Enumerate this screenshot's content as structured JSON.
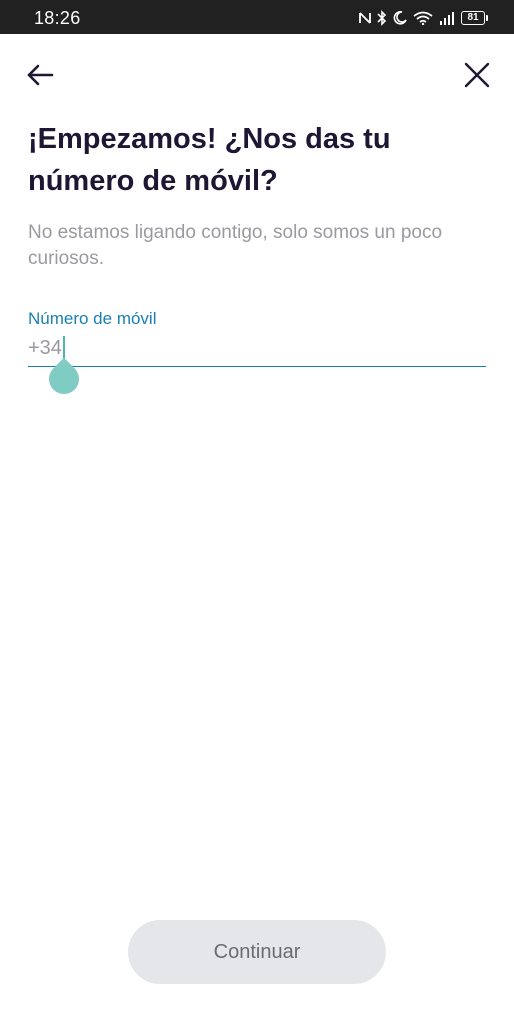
{
  "status_bar": {
    "time": "18:26",
    "battery_level": "81",
    "icons": [
      "nfc-icon",
      "bluetooth-icon",
      "moon-icon",
      "wifi-icon",
      "signal-icon",
      "battery-icon"
    ]
  },
  "header": {
    "back_icon": "arrow-left-icon",
    "close_icon": "close-icon"
  },
  "content": {
    "title": "¡Empezamos! ¿Nos das tu número de móvil?",
    "subtitle": "No estamos ligando contigo, solo somos un poco curiosos."
  },
  "phone_field": {
    "label": "Número de móvil",
    "prefix": "+34",
    "value": ""
  },
  "footer": {
    "continue_label": "Continuar"
  },
  "colors": {
    "title": "#1e1633",
    "accent": "#1a7fb3",
    "muted_text": "#9a9aa0",
    "button_bg": "#e4e6ea",
    "caret": "#80cbc4"
  }
}
